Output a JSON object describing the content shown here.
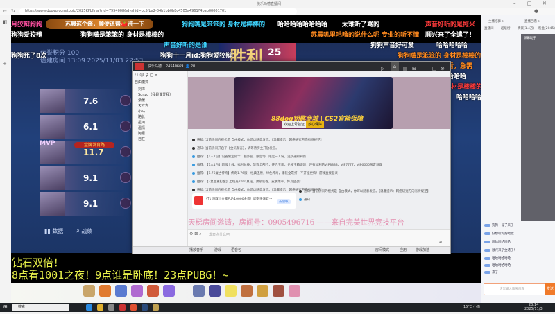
{
  "browser": {
    "tab_title": "快乐马德直播间",
    "url": "https://www.douyu.com/topic/2025KPLfinal?rid=7954008&dyshid=bc5fba2-84b1bb0b8c4505a4961?4bab00001701"
  },
  "danmaku": [
    {
      "text": "月狡辩狗狗",
      "color": "p"
    },
    {
      "text": "狗狗嘴是笨笨的 身材是棒棒的",
      "color": "c"
    },
    {
      "text": "哈哈哈哈哈哈哈哈",
      "color": "w"
    },
    {
      "text": "太难听了骂的",
      "color": "w"
    },
    {
      "text": "声音好听的是拖米",
      "color": "r"
    },
    {
      "text": "狗狗爱狡辩",
      "color": "w"
    },
    {
      "text": "狗狗嘴是笨笨的 身材是棒棒的",
      "color": "w"
    },
    {
      "text": "苏晨叽里咕噜的说什么呢 专业的听不懂",
      "color": "o"
    },
    {
      "text": "顺兴来了全遣了！",
      "color": "w"
    },
    {
      "text": "声音好听的是谁",
      "color": "c"
    },
    {
      "text": "狗狗声音好可爱",
      "color": "w"
    },
    {
      "text": "哈哈哈哈哈",
      "color": "w"
    },
    {
      "text": "狗狗死了8次",
      "color": "w"
    },
    {
      "text": "狗狗十一月id:狗狗爱狡辩",
      "color": "w"
    },
    {
      "text": "狗狗嘴是笨笨的 身材是棒棒的",
      "color": "o"
    },
    {
      "text": "在哪看，急需",
      "color": "o"
    },
    {
      "text": "哈哈哈哈哈",
      "color": "w"
    },
    {
      "text": "的 身材是棒棒的",
      "color": "r"
    },
    {
      "text": "哈哈哈哈哈",
      "color": "w"
    }
  ],
  "gift_banner": "苏晨这个酱，顺便还帮🍅洗一下",
  "game": {
    "victory": "胜利",
    "victory_num": "25",
    "credit": "信誉积分 100",
    "created": "创建房间   13:09    2025/11/03 22:53",
    "players": [
      {
        "score": "7.6"
      },
      {
        "score": "6.1"
      },
      {
        "score": "11.7",
        "mvp": "MVP",
        "badge": "金牌发育路"
      },
      {
        "score": "9.1"
      },
      {
        "score": "9.1"
      }
    ],
    "tabs": [
      "数据",
      "战绩"
    ]
  },
  "subtitles": [
    "钻石双倍！",
    "8点看1001之夜！9点谁是卧底！23点PUBG！~"
  ],
  "app": {
    "room_name": "快乐马德",
    "room_id": "24540669",
    "online": "20",
    "mode": "自由模式",
    "members": [
      "刘洋",
      "Sunzu（我是谁爱我）",
      "渐暖",
      "天才吉",
      "小马",
      "路长",
      "星河",
      "温情",
      "阿豪",
      "自在"
    ],
    "banner_title": "88dog钥匙商城 | CS2官箱保障",
    "banner_sub": "欢迎上号验证",
    "banner_btn": "放心保障",
    "messages": [
      "通知: 当前房间的模式是 自由模式，你可以随意发言。【温馨提示：网络研究方向有待规范】",
      "通知: 当前房间开启了【全员禁言】，请等待房主开放发言。",
      "推荐: 【1人1包】设置限定房卡：额外包、限定场！限定一人份，连续通知刷新！",
      "推荐: 【1人1包】新版上线，福利兑换，等等全部打，开启宝箱，兑换宝箱即送，还有福利的VIP8888、VIP7777、VIP6666限定领取",
      "推荐: 【1.76复古传奇】传奇1.76版，经典还原，绿色传奇，爆装全靠打，不开挂更快！游戏直接登录",
      "推荐: 【2复古重打金】上线充2000真钻，顶级装备，皮肤爆率，好友团战！",
      "通知: 当前房间的模式是 自由模式，你可以随意发言。【温馨提示：网络研究方向有待规范】",
      "通知: 当前房间的模式是 自由模式，你可以随意发言。【温馨提示：网络研究方向有待规范】",
      "通知"
    ],
    "invite_card_title": "打1 领取小金库已达10000金币！即刻快领取～",
    "invite_card_btn": "去领取",
    "invite_text": "天梯房间邀请，房间号：0905496716 ——来自完美世界竞技平台",
    "input_placeholder": "发表点什么吧",
    "footer": [
      "播放音乐",
      "游戏",
      "语音包"
    ],
    "footer_right": [
      "房间模式",
      "应用",
      "游戏加速"
    ]
  },
  "right_panel": {
    "top_links": [
      "主播招募 >",
      "直播回看 >"
    ],
    "tabs": [
      "直播间",
      "超级榜",
      "贵宾(1.4万)",
      "粉丝(2045)"
    ],
    "overlay_title": "弹幕助手",
    "chats": [
      "狗狗十号子来了",
      "好想听狗狗唱歌",
      "哈哈哈哈哈哈",
      "顺兴来了全遣了！",
      "哈哈哈哈哈哈",
      "哈哈哈哈哈哈",
      "来了"
    ],
    "input_placeholder": "这里输入聊天内容",
    "send": "发送"
  },
  "taskbar": {
    "search": "搜索",
    "weather": "15°C 小雨",
    "time": "23:14",
    "date": "2025/11/3"
  }
}
